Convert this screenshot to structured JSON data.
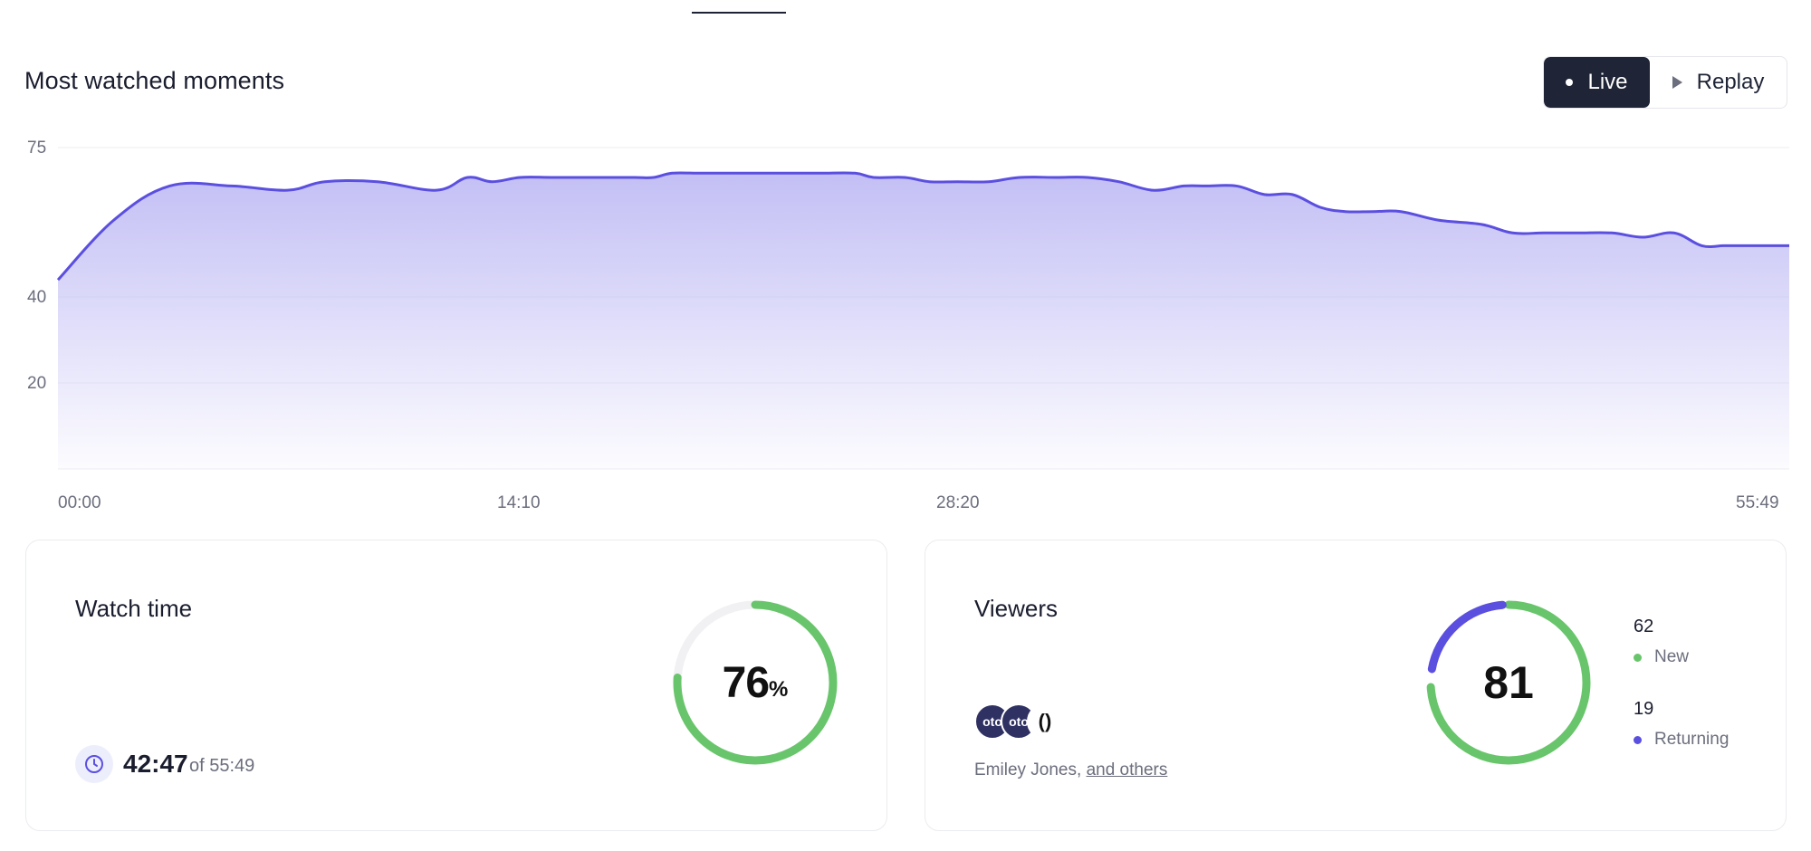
{
  "page": {
    "title": "Most watched moments",
    "toggle": {
      "live_label": "Live",
      "replay_label": "Replay",
      "active": "Live"
    }
  },
  "colors": {
    "line": "#5b4fe0",
    "area_top": "#c7c4f6",
    "green": "#69c56b",
    "purple": "#5b4fe0",
    "dark": "#1f2436",
    "track": "#f1f1f3"
  },
  "chart_data": {
    "type": "area",
    "title": "Most watched moments",
    "y_ticks": [
      "75",
      "40",
      "20"
    ],
    "x_ticks": [
      "00:00",
      "14:10",
      "28:20",
      "55:49"
    ],
    "grid": true,
    "x": [
      0.0,
      1.8,
      3.6,
      5.6,
      7.4,
      8.6,
      10.3,
      12.2,
      13.2,
      14.0,
      14.9,
      15.9,
      16.9,
      17.5,
      18.6,
      19.2,
      19.8,
      20.6,
      21.5,
      22.5,
      23.6,
      24.6,
      25.7,
      26.3,
      27.3,
      28.1,
      29.0,
      30.0,
      31.0,
      32.2,
      33.2,
      34.2,
      35.3,
      36.3,
      37.0,
      38.0,
      38.9,
      39.8,
      40.7,
      41.5,
      42.4,
      43.3,
      44.5,
      45.9,
      46.9,
      47.9,
      49.0,
      50.1,
      51.1,
      52.1,
      53.0,
      53.7,
      54.3,
      55.0,
      55.82
    ],
    "values": [
      44,
      58,
      66,
      66,
      65,
      67,
      67,
      65,
      68,
      67,
      68,
      68,
      68,
      68,
      68,
      68,
      69,
      69,
      69,
      69,
      69,
      69,
      69,
      68,
      68,
      67,
      67,
      67,
      68,
      68,
      68,
      67,
      65,
      66,
      66,
      66,
      64,
      64,
      61,
      60,
      60,
      60,
      58,
      57,
      55,
      55,
      55,
      55,
      54,
      55,
      52,
      52,
      52,
      52,
      52
    ],
    "xlabel": "",
    "ylabel": ""
  },
  "watch_time": {
    "title": "Watch time",
    "percent": "76",
    "percent_sign": "%",
    "percent_value": 76,
    "value": "42:47",
    "of_text": "of 55:49"
  },
  "viewers": {
    "title": "Viewers",
    "total": "81",
    "avatars": [
      "oto",
      "oto",
      "()"
    ],
    "names": "Emiley Jones,",
    "others": "and others",
    "new_count": "62",
    "new_label": "New",
    "new_value": 62,
    "returning_count": "19",
    "returning_label": "Returning",
    "returning_value": 19
  }
}
